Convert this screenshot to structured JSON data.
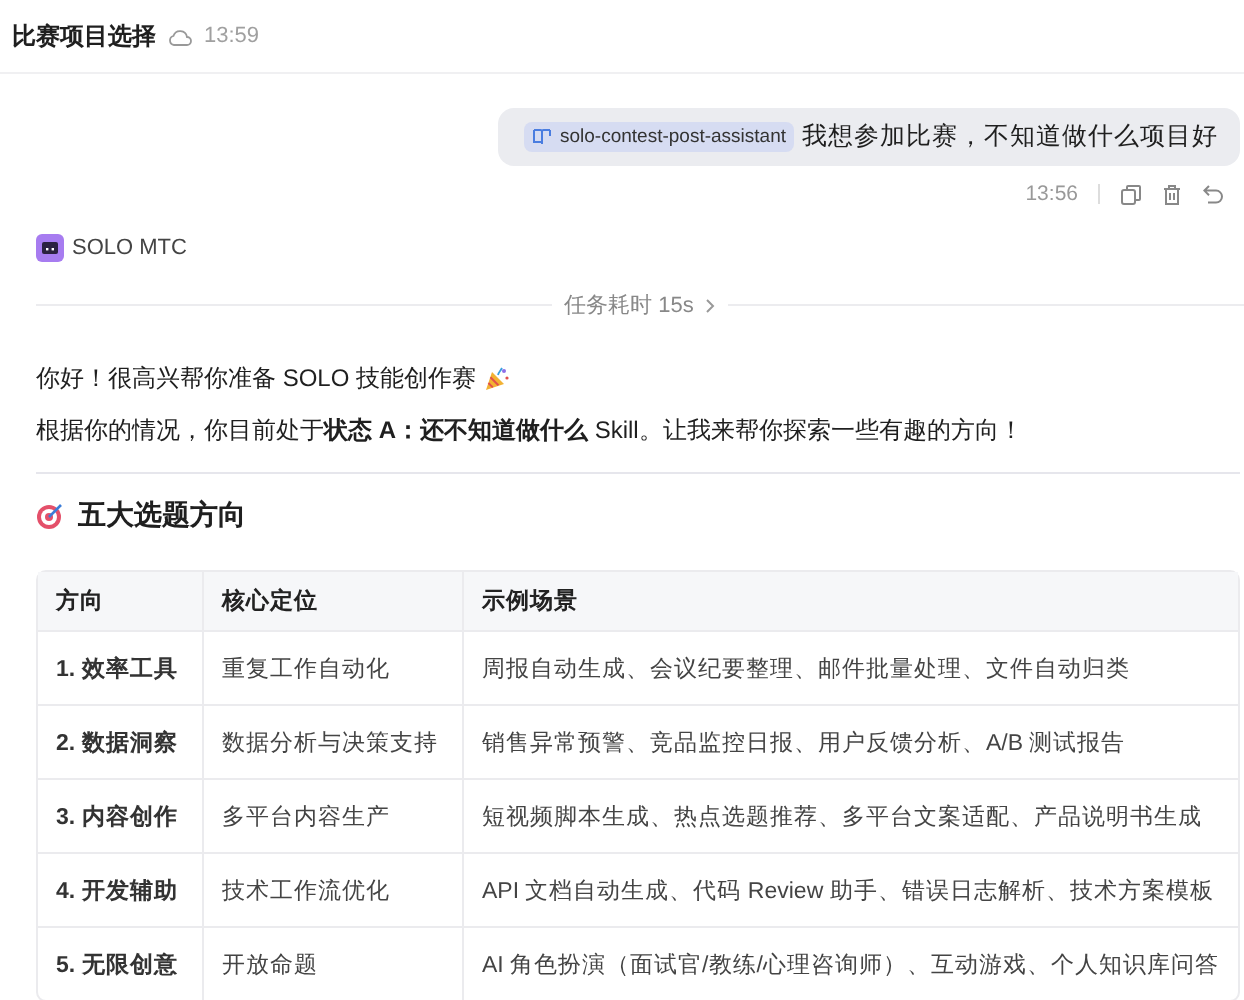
{
  "header": {
    "title": "比赛项目选择",
    "time": "13:59"
  },
  "user_message": {
    "tag": "solo-contest-post-assistant",
    "text": "我想参加比赛，不知道做什么项目好",
    "time": "13:56"
  },
  "assistant": {
    "name": "SOLO MTC",
    "task_time": "任务耗时 15s"
  },
  "paragraphs": [
    "你好！很高兴帮你准备 SOLO 技能创作赛",
    "根据你的情况，你目前处于**状态 A：还不知道做什么** Skill。让我来帮你探索一些有趣的方向！"
  ],
  "heading": "五大选题方向",
  "table": {
    "columns": [
      "方向",
      "核心定位",
      "示例场景"
    ],
    "rows": [
      [
        "1. 效率工具",
        "重复工作自动化",
        "周报自动生成、会议纪要整理、邮件批量处理、文件自动归类"
      ],
      [
        "2. 数据洞察",
        "数据分析与决策支持",
        "销售异常预警、竞品监控日报、用户反馈分析、A/B 测试报告"
      ],
      [
        "3. 内容创作",
        "多平台内容生产",
        "短视频脚本生成、热点选题推荐、多平台文案适配、产品说明书生成"
      ],
      [
        "4. 开发辅助",
        "技术工作流优化",
        "API 文档自动生成、代码 Review 助手、错误日志解析、技术方案模板"
      ],
      [
        "5. 无限创意",
        "开放命题",
        "AI 角色扮演（面试官/教练/心理咨询师）、互动游戏、个人知识库问答"
      ]
    ]
  }
}
